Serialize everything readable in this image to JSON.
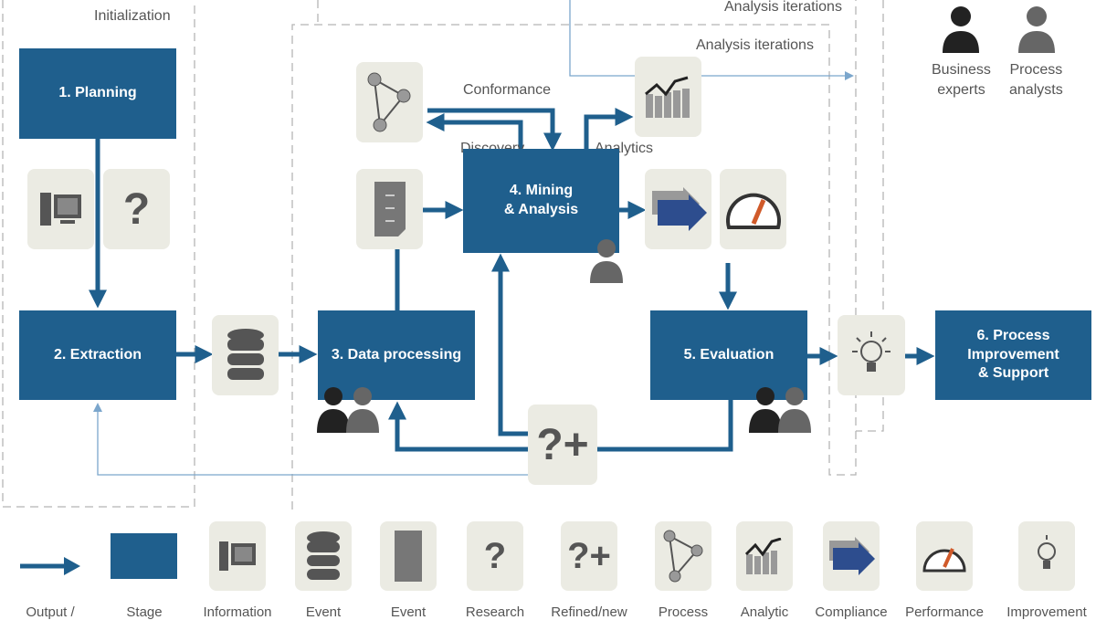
{
  "phases": {
    "initialization": "Initialization",
    "analysis_iterations_outer": "Analysis iterations",
    "analysis_iterations_inner": "Analysis iterations"
  },
  "stages": {
    "s1": "1. Planning",
    "s2": "2. Extraction",
    "s3": "3. Data processing",
    "s4a": "4. Mining",
    "s4b": "& Analysis",
    "s5": "5. Evaluation",
    "s6a": "6. Process",
    "s6b": "Improvement",
    "s6c": "& Support"
  },
  "flows": {
    "conformance": "Conformance",
    "discovery": "Discovery",
    "analytics": "Analytics"
  },
  "roles": {
    "business_a": "Business",
    "business_b": "experts",
    "analyst_a": "Process",
    "analyst_b": "analysts"
  },
  "icons": {
    "research": "?",
    "refined": "?+"
  },
  "legend": [
    "Output /",
    "Stage",
    "Information",
    "Event",
    "Event",
    "Research",
    "Refined/new",
    "Process",
    "Analytic",
    "Compliance",
    "Performance",
    "Improvement"
  ],
  "colors": {
    "stage": "#1f5f8d",
    "icon_bg": "#ebebe3",
    "thin_line": "#7ba6cc",
    "dashed": "#b0b0b0"
  }
}
